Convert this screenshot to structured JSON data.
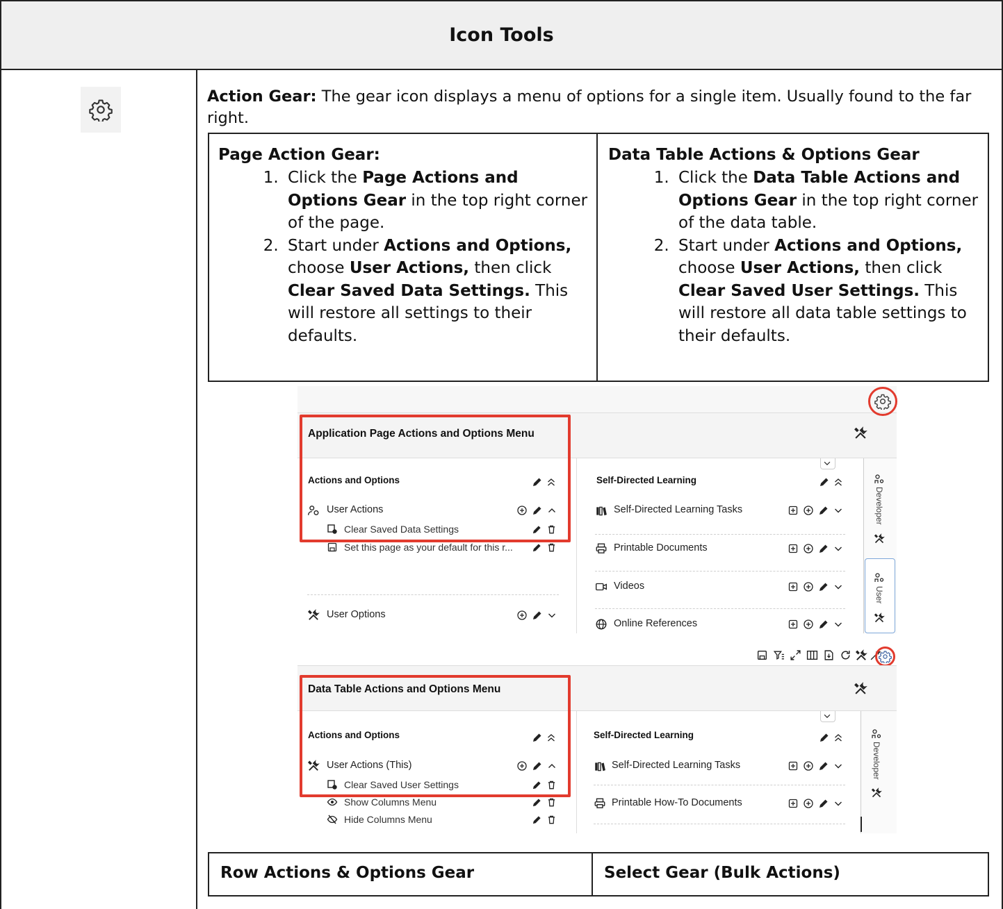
{
  "header": {
    "title": "Icon Tools"
  },
  "intro": {
    "label": "Action Gear:",
    "text": " The gear icon displays a menu of options for a single item. Usually found to the far right."
  },
  "page_action_gear": {
    "heading": "Page Action Gear:",
    "steps": [
      {
        "pre": "Click the ",
        "bold": "Page Actions and Options Gear",
        "post": " in the top right corner of the page."
      },
      {
        "pre": "Start under ",
        "bold": "Actions and Options,",
        "mid": " choose ",
        "bold2": "User Actions,",
        "mid2": " then click ",
        "bold3": "Clear Saved Data Settings.",
        "post": " This will restore all settings to their defaults."
      }
    ]
  },
  "data_table_gear": {
    "heading": "Data Table Actions & Options Gear",
    "steps": [
      {
        "pre": "Click the ",
        "bold": "Data Table Actions and Options Gear",
        "post": " in the top right corner of the data table."
      },
      {
        "pre": "Start under ",
        "bold": "Actions and Options,",
        "mid": " choose ",
        "bold2": "User Actions,",
        "mid2": " then click ",
        "bold3": "Clear Saved User Settings.",
        "post": " This will restore all data table settings to their defaults."
      }
    ]
  },
  "shot1": {
    "title": "Application Page Actions and Options Menu",
    "left_section": "Actions and Options",
    "user_actions": "User Actions",
    "clear_saved": "Clear Saved Data Settings",
    "set_default": "Set this page as your default for this r...",
    "user_options": "User Options",
    "right_section": "Self-Directed Learning",
    "r_items": [
      "Self-Directed Learning Tasks",
      "Printable Documents",
      "Videos",
      "Online References"
    ],
    "tab_developer": "Developer",
    "tab_user": "User"
  },
  "shot2": {
    "title": "Data Table Actions and Options Menu",
    "left_section": "Actions and Options",
    "user_actions": "User Actions (This)",
    "clear_saved": "Clear Saved User Settings",
    "show_cols": "Show Columns Menu",
    "hide_cols": "Hide Columns Menu",
    "right_section": "Self-Directed Learning",
    "r_items": [
      "Self-Directed Learning Tasks",
      "Printable How-To Documents"
    ],
    "tab_developer": "Developer"
  },
  "bottom_table": {
    "left": "Row Actions & Options Gear",
    "right": "Select Gear (Bulk Actions)"
  },
  "colors": {
    "accent_red": "#e23b2e",
    "border": "#222222",
    "header_bg": "#efefef"
  }
}
